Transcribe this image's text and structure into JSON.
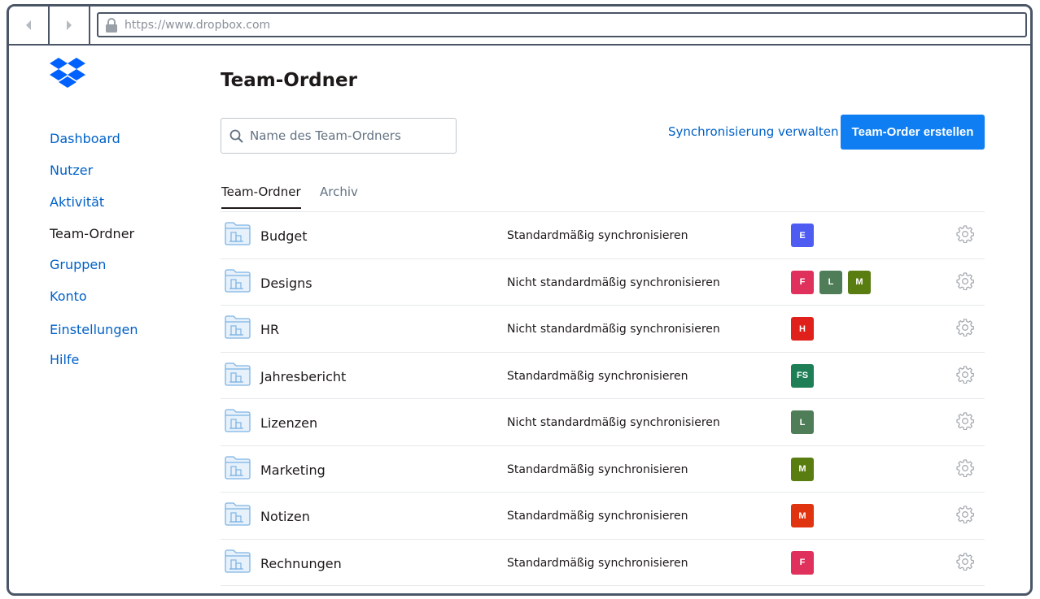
{
  "browser": {
    "url": "https://www.dropbox.com"
  },
  "sidebar": {
    "items": [
      {
        "label": "Dashboard",
        "active": false
      },
      {
        "label": "Nutzer",
        "active": false
      },
      {
        "label": "Aktivität",
        "active": false
      },
      {
        "label": "Team-Ordner",
        "active": true
      },
      {
        "label": "Gruppen",
        "active": false
      },
      {
        "label": "Konto",
        "active": false
      },
      {
        "label": "Einstellungen",
        "active": false
      },
      {
        "label": "Hilfe",
        "active": false
      }
    ]
  },
  "header": {
    "title": "Team-Ordner"
  },
  "search": {
    "placeholder": "Name des Team-Ordners"
  },
  "actions": {
    "sync_link": "Synchronisierung verwalten",
    "create_button": "Team-Order erstellen"
  },
  "tabs": [
    {
      "label": "Team-Ordner",
      "active": true
    },
    {
      "label": "Archiv",
      "active": false
    }
  ],
  "colors": {
    "accent": "#0061c7",
    "primary_button": "#0f7ef2"
  },
  "folders": [
    {
      "name": "Budget",
      "sync": "Standardmäßig synchronisieren",
      "members": [
        {
          "initials": "E",
          "color": "#4f5cf2"
        }
      ]
    },
    {
      "name": "Designs",
      "sync": "Nicht standardmäßig synchronisieren",
      "members": [
        {
          "initials": "F",
          "color": "#e0315d"
        },
        {
          "initials": "L",
          "color": "#4e7d58"
        },
        {
          "initials": "M",
          "color": "#5a7d12"
        }
      ]
    },
    {
      "name": "HR",
      "sync": "Nicht standardmäßig synchronisieren",
      "members": [
        {
          "initials": "H",
          "color": "#e0201a"
        }
      ]
    },
    {
      "name": "Jahresbericht",
      "sync": "Standardmäßig synchronisieren",
      "members": [
        {
          "initials": "FS",
          "color": "#1e7f57"
        }
      ]
    },
    {
      "name": "Lizenzen",
      "sync": "Nicht standardmäßig synchronisieren",
      "members": [
        {
          "initials": "L",
          "color": "#4e7d58"
        }
      ]
    },
    {
      "name": "Marketing",
      "sync": "Standardmäßig synchronisieren",
      "members": [
        {
          "initials": "M",
          "color": "#5a7d12"
        }
      ]
    },
    {
      "name": "Notizen",
      "sync": "Standardmäßig synchronisieren",
      "members": [
        {
          "initials": "M",
          "color": "#e0330f"
        }
      ]
    },
    {
      "name": "Rechnungen",
      "sync": "Standardmäßig synchronisieren",
      "members": [
        {
          "initials": "F",
          "color": "#e0315d"
        }
      ]
    }
  ]
}
